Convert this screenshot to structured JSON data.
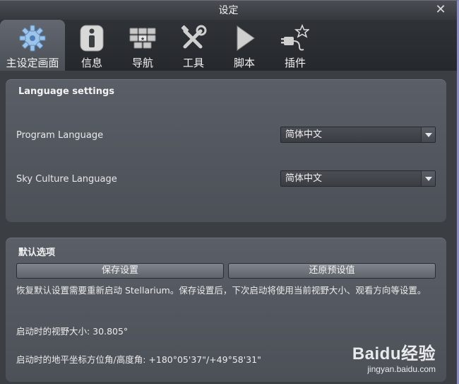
{
  "window": {
    "title": "设定",
    "close_icon": "close-icon"
  },
  "tabs": [
    {
      "label": "主设定画面",
      "icon": "gear-icon",
      "active": true
    },
    {
      "label": "信息",
      "icon": "info-icon",
      "active": false
    },
    {
      "label": "导航",
      "icon": "navigation-icon",
      "active": false
    },
    {
      "label": "工具",
      "icon": "tools-icon",
      "active": false
    },
    {
      "label": "脚本",
      "icon": "play-icon",
      "active": false
    },
    {
      "label": "插件",
      "icon": "plugin-icon",
      "active": false
    }
  ],
  "language": {
    "title": "Language settings",
    "program_label": "Program Language",
    "program_value": "简体中文",
    "sky_label": "Sky Culture Language",
    "sky_value": "简体中文"
  },
  "defaults": {
    "title": "默认选项",
    "save_button": "保存设置",
    "restore_button": "还原预设值",
    "note": "恢复默认设置需要重新启动 Stellarium。保存设置后，下次启动将使用当前视野大小、观看方向等设置。",
    "fov_text": "启动时的视野大小: 30.805°",
    "direction_text": "启动时的地平坐标方位角/高度角: +180°05'37\"/+49°58'31\""
  },
  "watermark": {
    "brand": "Baidu经验",
    "url": "jingyan.baidu.com"
  },
  "colors": {
    "accent_border": "#8a8ec8",
    "panel": "#4c5057",
    "background": "#2a2d31"
  }
}
